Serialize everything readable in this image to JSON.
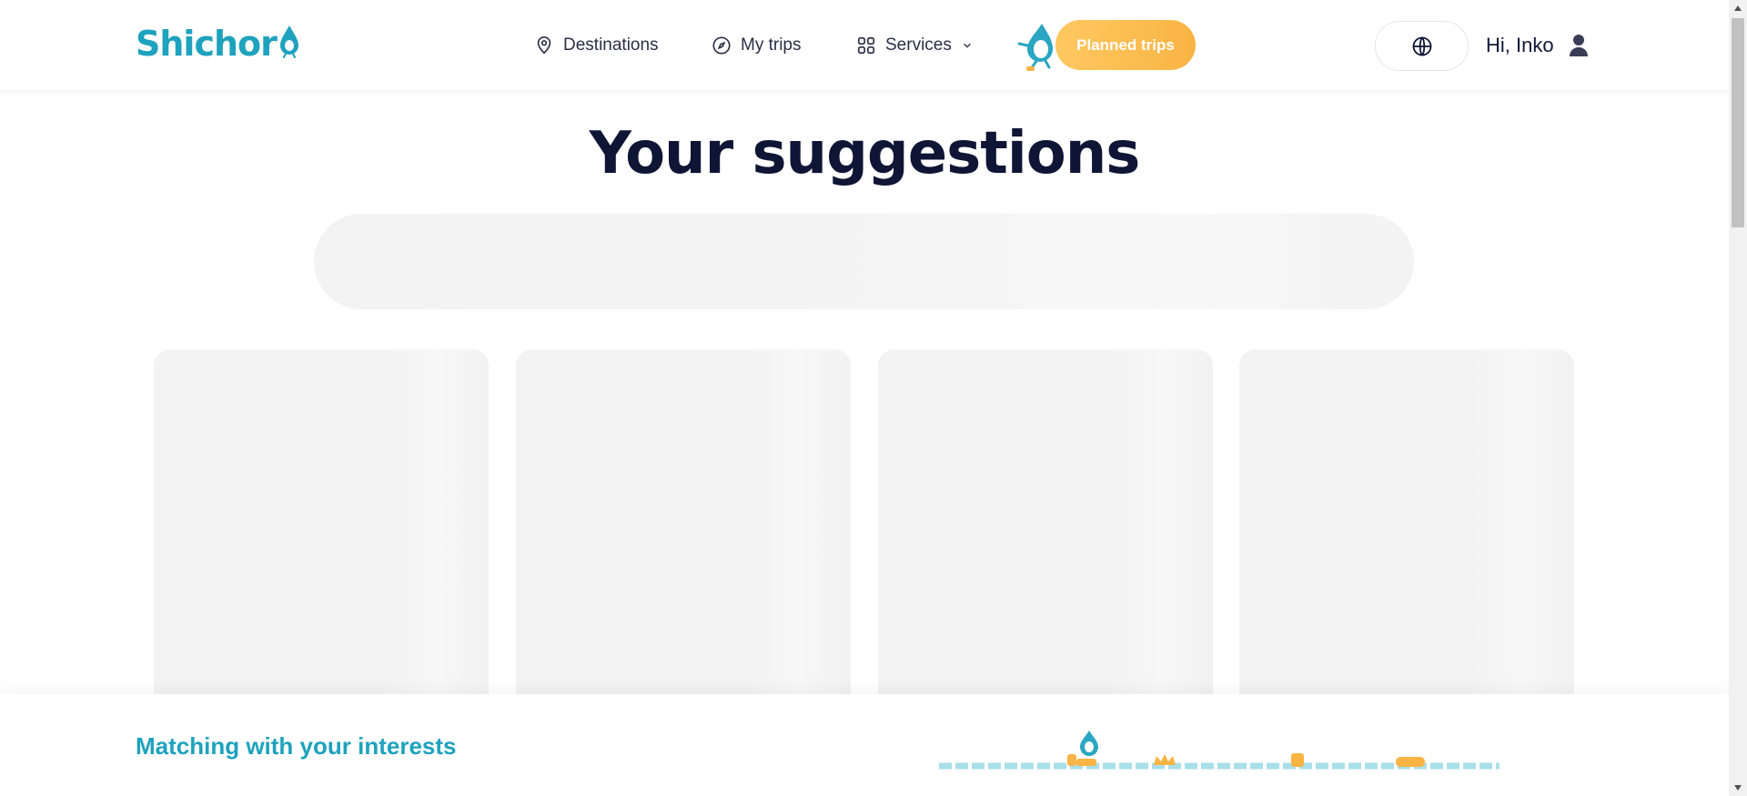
{
  "header": {
    "logo": "Shichor",
    "nav": {
      "destinations": "Destinations",
      "my_trips": "My trips",
      "services": "Services"
    },
    "planned_trips": "Planned trips",
    "greeting": "Hi, Inko"
  },
  "main": {
    "title": "Your suggestions"
  },
  "bottom": {
    "status": "Matching with your interests"
  },
  "colors": {
    "brand": "#1ea2be",
    "accent": "#f9b443",
    "title": "#0f1535"
  },
  "icons": [
    "location-pin-icon",
    "compass-icon",
    "grid-icon",
    "chevron-down-icon",
    "globe-icon",
    "user-icon"
  ]
}
